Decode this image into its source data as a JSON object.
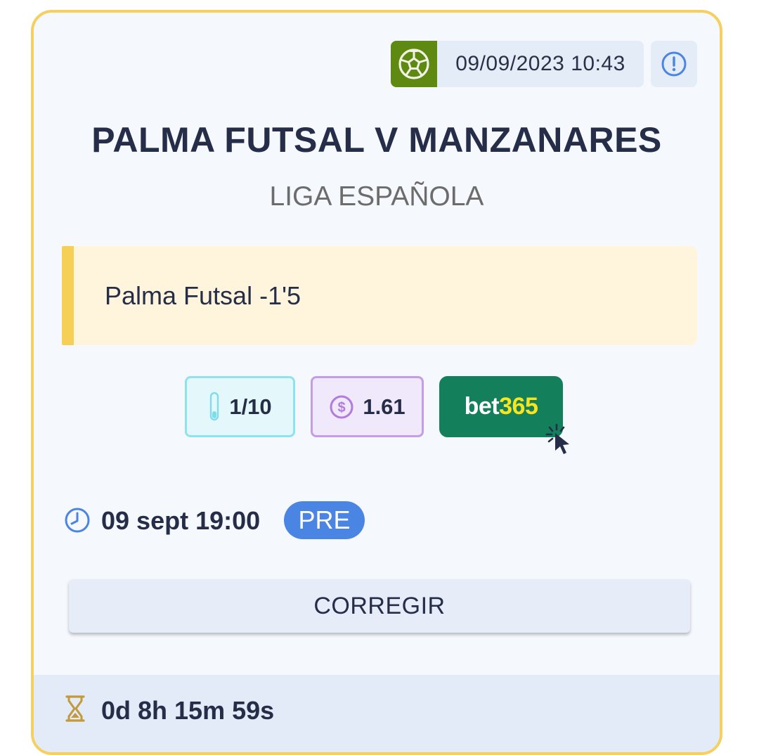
{
  "header": {
    "sport_icon": "soccer-ball-icon",
    "datetime": "09/09/2023 10:43",
    "info_icon": "exclamation-circle-icon"
  },
  "match": {
    "title": "PALMA FUTSAL V MANZANARES",
    "league": "LIGA ESPAÑOLA"
  },
  "pick": {
    "text": "Palma Futsal -1'5"
  },
  "chips": {
    "stake_icon": "thermometer-icon",
    "stake": "1/10",
    "odds_icon": "dollar-coin-icon",
    "odds": "1.61",
    "bookmaker_part1": "bet",
    "bookmaker_part2": "365",
    "bookmaker_colors": {
      "bg": "#137f5b",
      "text": "#ffffff",
      "accent": "#f8e51e"
    }
  },
  "event": {
    "clock_icon": "clock-icon",
    "time": "09 sept 19:00",
    "status": "PRE"
  },
  "actions": {
    "correct_label": "CORREGIR"
  },
  "footer": {
    "hourglass_icon": "hourglass-icon",
    "countdown": "0d 8h 15m 59s"
  },
  "colors": {
    "card_border": "#f5d060",
    "sport_badge": "#5e8a12",
    "status_badge": "#4a85e3",
    "pick_accent": "#f6cf56"
  }
}
